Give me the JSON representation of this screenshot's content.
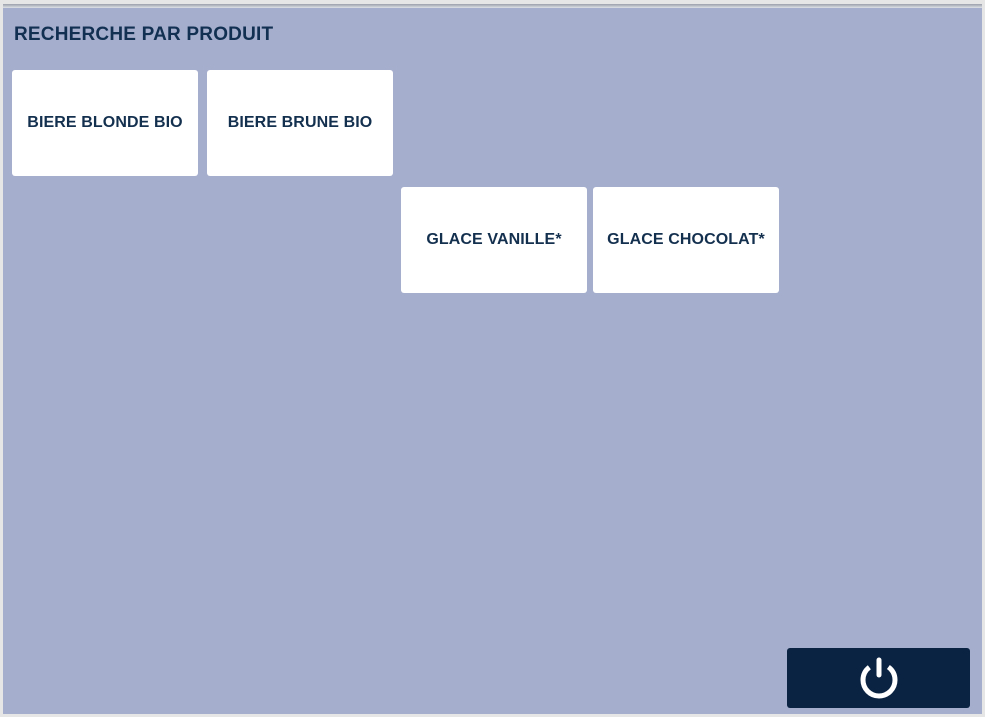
{
  "header": {
    "title": "RECHERCHE PAR PRODUIT"
  },
  "products": [
    {
      "label": "BIERE BLONDE BIO"
    },
    {
      "label": "BIERE BRUNE BIO"
    },
    {
      "label": "GLACE VANILLE*"
    },
    {
      "label": "GLACE CHOCOLAT*"
    }
  ],
  "footer": {
    "power_icon": "power-icon"
  },
  "colors": {
    "background": "#a6aecd",
    "text": "#123052",
    "button_dark": "#0a2342",
    "tile": "#ffffff"
  }
}
